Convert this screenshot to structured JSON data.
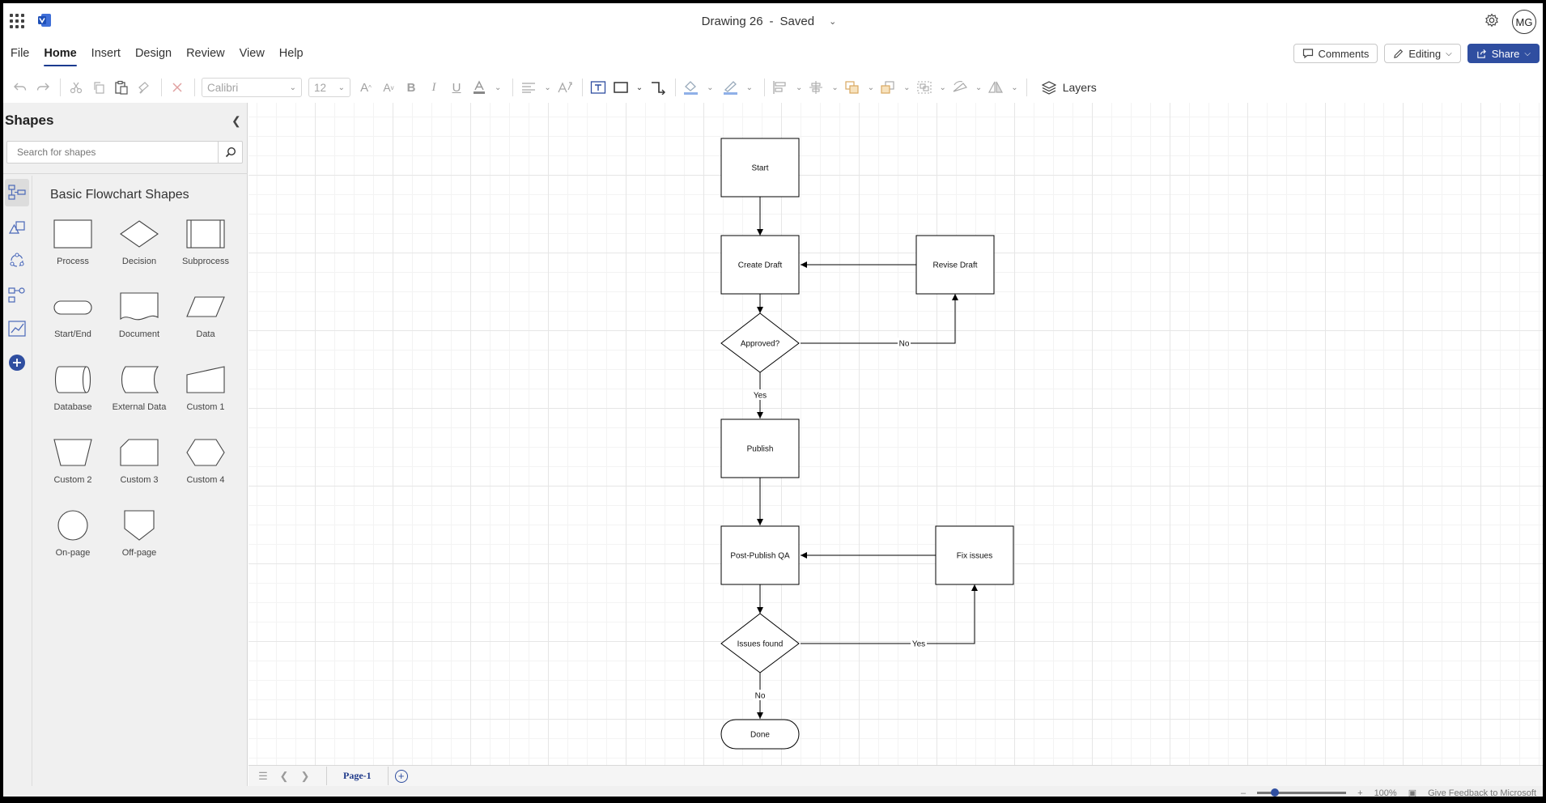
{
  "titlebar": {
    "doc_name": "Drawing 26",
    "separator": "-",
    "save_state": "Saved",
    "avatar_initials": "MG"
  },
  "menu": {
    "tabs": [
      {
        "label": "File"
      },
      {
        "label": "Home"
      },
      {
        "label": "Insert"
      },
      {
        "label": "Design"
      },
      {
        "label": "Review"
      },
      {
        "label": "View"
      },
      {
        "label": "Help"
      }
    ],
    "active_tab": "Home",
    "comments_label": "Comments",
    "editing_label": "Editing",
    "share_label": "Share"
  },
  "toolbar": {
    "font_name": "Calibri",
    "font_size": "12",
    "layers_label": "Layers"
  },
  "shapes_panel": {
    "title": "Shapes",
    "search_placeholder": "Search for shapes",
    "stencil_title": "Basic Flowchart Shapes",
    "items": [
      {
        "label": "Process",
        "icon": "process-shape"
      },
      {
        "label": "Decision",
        "icon": "decision-shape"
      },
      {
        "label": "Subprocess",
        "icon": "subprocess-shape"
      },
      {
        "label": "Start/End",
        "icon": "terminator-shape"
      },
      {
        "label": "Document",
        "icon": "document-shape"
      },
      {
        "label": "Data",
        "icon": "data-shape"
      },
      {
        "label": "Database",
        "icon": "database-shape"
      },
      {
        "label": "External Data",
        "icon": "external-data-shape"
      },
      {
        "label": "Custom 1",
        "icon": "manual-input-shape"
      },
      {
        "label": "Custom 2",
        "icon": "manual-operation-shape"
      },
      {
        "label": "Custom 3",
        "icon": "card-shape"
      },
      {
        "label": "Custom 4",
        "icon": "preparation-shape"
      },
      {
        "label": "On-page",
        "icon": "on-page-connector-shape"
      },
      {
        "label": "Off-page",
        "icon": "off-page-connector-shape"
      }
    ]
  },
  "diagram": {
    "nodes": {
      "start": "Start",
      "create_draft": "Create Draft",
      "revise_draft": "Revise Draft",
      "approved": "Approved?",
      "publish": "Publish",
      "post_publish_qa": "Post-Publish QA",
      "fix_issues": "Fix issues",
      "issues_found": "Issues found",
      "done": "Done"
    },
    "edges": {
      "approved_no": "No",
      "approved_yes": "Yes",
      "issues_yes": "Yes",
      "issues_no": "No"
    }
  },
  "pagebar": {
    "page_tab": "Page-1"
  },
  "statusbar": {
    "zoom": "100%",
    "zoom_fraction": 0.2,
    "feedback": "Give Feedback to Microsoft"
  },
  "colors": {
    "accent": "#2f4ea0",
    "panel_bg": "#f0f0f0"
  }
}
